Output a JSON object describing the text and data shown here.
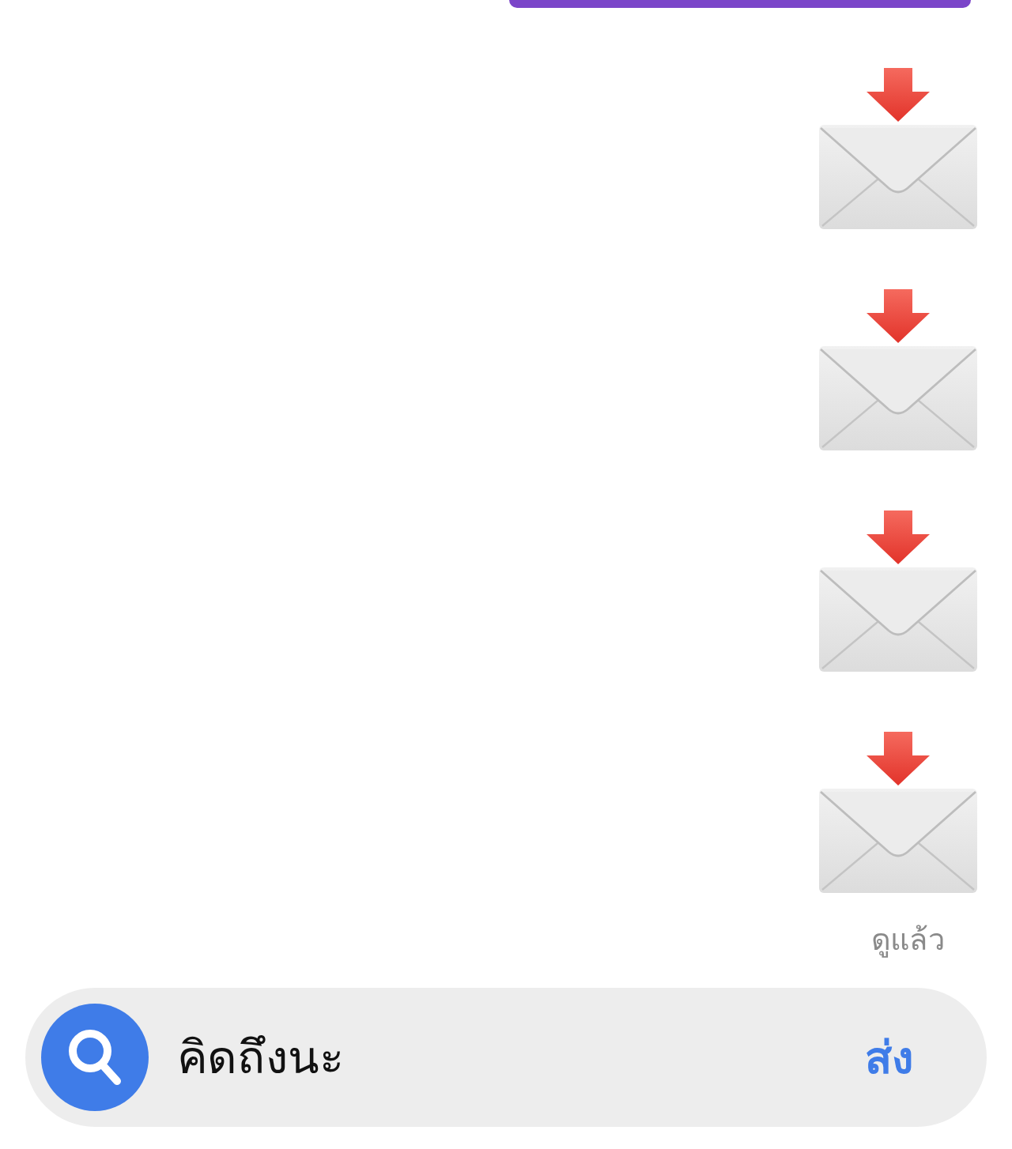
{
  "messages": [
    {
      "kind": "bubble",
      "color": "#7b45c9"
    },
    {
      "kind": "envelope"
    },
    {
      "kind": "envelope"
    },
    {
      "kind": "envelope"
    },
    {
      "kind": "envelope"
    }
  ],
  "read_receipt": "ดูแล้ว",
  "composer": {
    "value": "คิดถึงนะ",
    "send": "ส่ง"
  }
}
